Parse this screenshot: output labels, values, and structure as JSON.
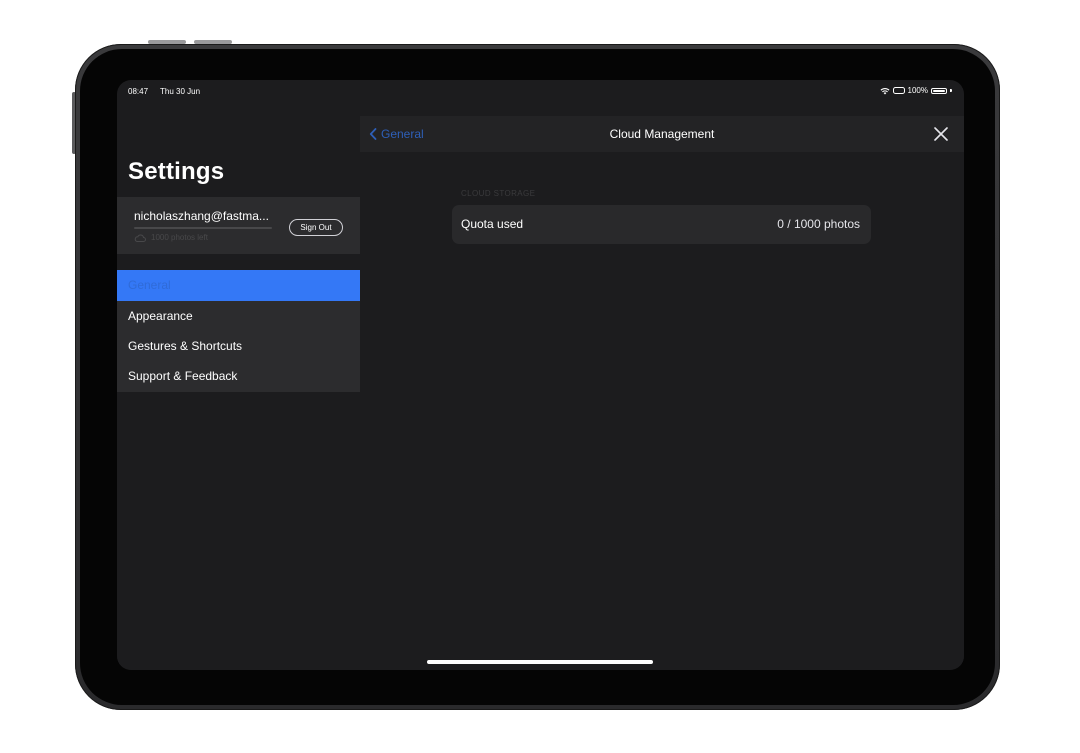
{
  "status_bar": {
    "time": "08:47",
    "date": "Thu 30 Jun",
    "battery": "100%"
  },
  "sidebar": {
    "title": "Settings",
    "account": {
      "email": "nicholaszhang@fastma...",
      "quota_note": "1000 photos left",
      "sign_out_label": "Sign Out",
      "storage_used_fraction": 0
    },
    "items": [
      {
        "label": "General",
        "selected": true
      },
      {
        "label": "Appearance",
        "selected": false
      },
      {
        "label": "Gestures & Shortcuts",
        "selected": false
      },
      {
        "label": "Support & Feedback",
        "selected": false
      }
    ]
  },
  "detail": {
    "back_label": "General",
    "title": "Cloud Management",
    "section_header": "CLOUD STORAGE",
    "rows": [
      {
        "label": "Quota used",
        "value": "0 / 1000 photos"
      }
    ]
  },
  "colors": {
    "accent": "#3478f6",
    "background": "#1c1c1e",
    "card": "#2c2c2e"
  }
}
